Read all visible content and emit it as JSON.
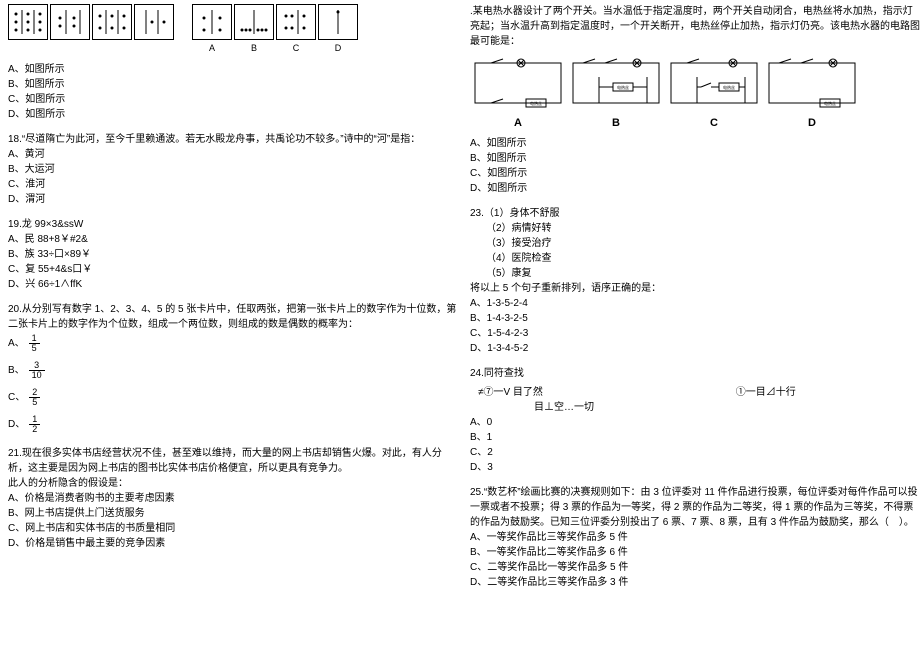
{
  "left": {
    "q17": {
      "answer_labels": [
        "A",
        "B",
        "C",
        "D"
      ],
      "opts": [
        "A、如图所示",
        "B、如图所示",
        "C、如图所示",
        "D、如图所示"
      ]
    },
    "q18": {
      "stem": "18.“尽道隋亡为此河，至今千里赖通波。若无水殿龙舟事，共禹论功不较多。”诗中的“河”是指：",
      "opts": [
        "A、黄河",
        "B、大运河",
        "C、淮河",
        "D、渭河"
      ]
    },
    "q19": {
      "stem": "19.龙 99×3&ssW",
      "opts": [
        "A、民 88+8￥#2&",
        "B、族 33÷口×89￥",
        "C、复 55+4&s口￥",
        "D、兴 66÷1∧ffK"
      ]
    },
    "q20": {
      "stem": "20.从分别写有数字 1、2、3、4、5 的 5 张卡片中，任取两张，把第一张卡片上的数字作为十位数，第二张卡片上的数字作为个位数，组成一个两位数，则组成的数是偶数的概率为：",
      "opts": [
        "A、",
        "B、",
        "C、",
        "D、"
      ],
      "fracs": [
        {
          "n": "1",
          "d": "5"
        },
        {
          "n": "3",
          "d": "10"
        },
        {
          "n": "2",
          "d": "5"
        },
        {
          "n": "1",
          "d": "2"
        }
      ]
    },
    "q21": {
      "stem1": "21.现在很多实体书店经营状况不佳，甚至难以维持，而大量的网上书店却销售火爆。对此，有人分析，这主要是因为网上书店的图书比实体书店价格便宜，所以更具有竞争力。",
      "stem2": "此人的分析隐含的假设是：",
      "opts": [
        "A、价格是消费者购书的主要考虑因素",
        "B、网上书店提供上门送货服务",
        "C、网上书店和实体书店的书质量相同",
        "D、价格是销售中最主要的竞争因素"
      ]
    }
  },
  "right": {
    "q22": {
      "stem": ".某电热水器设计了两个开关。当水温低于指定温度时，两个开关自动闭合，电热丝将水加热，指示灯亮起；当水温升高到指定温度时，一个开关断开，电热丝停止加热，指示灯仍亮。该电热水器的电路图最可能是：",
      "labels": [
        "A",
        "B",
        "C",
        "D"
      ],
      "circuit_text": "电热丝",
      "opts": [
        "A、如图所示",
        "B、如图所示",
        "C、如图所示",
        "D、如图所示"
      ]
    },
    "q23": {
      "stem": "23.（1）身体不舒服",
      "items": [
        "（2）病情好转",
        "（3）接受治疗",
        "（4）医院检查",
        "（5）康复"
      ],
      "prompt": "将以上 5 个句子重新排列，语序正确的是：",
      "opts": [
        "A、1-3-5-2-4",
        "B、1-4-3-2-5",
        "C、1-5-4-2-3",
        "D、1-3-4-5-2"
      ]
    },
    "q24": {
      "stem": "24.同符查找",
      "line1a": "≠⑦一V 目了然",
      "line1b": "①一目⊿十行",
      "line2": "目⊥空…一切",
      "opts": [
        "A、0",
        "B、1",
        "C、2",
        "D、3"
      ]
    },
    "q25": {
      "stem": "25.“数艺杯”绘画比赛的决赛规则如下：由 3 位评委对 11 件作品进行投票，每位评委对每件作品可以投一票或者不投票；得 3 票的作品为一等奖，得 2 票的作品为二等奖，得 1 票的作品为三等奖，不得票的作品为鼓励奖。已知三位评委分别投出了 6 票、7 票、8 票，且有 3 件作品为鼓励奖，那么（　）。",
      "opts": [
        "A、一等奖作品比三等奖作品多 5 件",
        "B、一等奖作品比二等奖作品多 6 件",
        "C、二等奖作品比一等奖作品多 5 件",
        "D、二等奖作品比三等奖作品多 3 件"
      ]
    }
  }
}
